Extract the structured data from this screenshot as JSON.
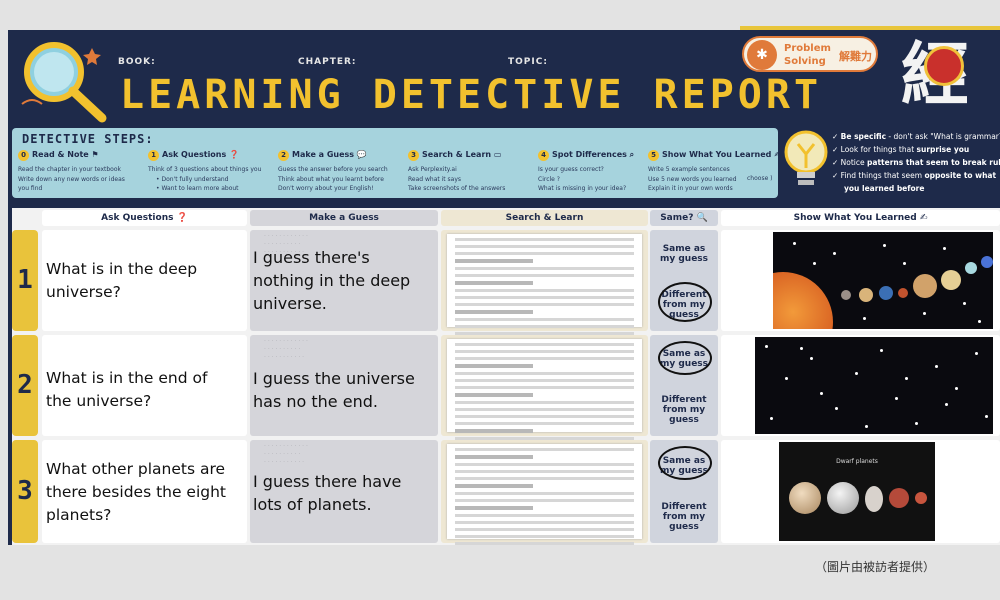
{
  "header": {
    "book_label": "BOOK:",
    "chapter_label": "CHAPTER:",
    "topic_label": "TOPIC:",
    "title": "LEARNING DETECTIVE REPORT",
    "badge_en": "Problem\nSolving",
    "badge_zh": "解難力",
    "logo_char": "經"
  },
  "steps": {
    "title": "DETECTIVE STEPS:",
    "items": [
      {
        "num": "0",
        "title": "Read & Note",
        "lines": [
          "Read the chapter in your textbook",
          "Write down any new words or ideas",
          "you find"
        ]
      },
      {
        "num": "1",
        "title": "Ask Questions ❓",
        "lines": [
          "Think of 3 questions about things you",
          "• Don't fully understand",
          "• Want to learn more about"
        ]
      },
      {
        "num": "2",
        "title": "Make a Guess",
        "lines": [
          "Guess the answer before you search",
          "Think about what you learnt before",
          "Don't worry about your English!"
        ]
      },
      {
        "num": "3",
        "title": "Search & Learn",
        "lines": [
          "Ask Perplexity.ai",
          "Read what it says",
          "Take screenshots of the answers"
        ]
      },
      {
        "num": "4",
        "title": "Spot Differences",
        "lines": [
          "Is your guess correct?",
          "Circle ?",
          "What is missing in your idea?"
        ]
      },
      {
        "num": "5",
        "title": "Show What You Learned ✍",
        "lines": [
          "Write 5 example sentences",
          "Use 5 new words you learned",
          "Explain it in your own words"
        ]
      }
    ],
    "tips": [
      {
        "bold": "Be specific",
        "rest": " - don't ask \"What is grammar?\""
      },
      {
        "pre": "Look for things that ",
        "bold": "surprise you",
        "rest": ""
      },
      {
        "pre": "Notice ",
        "bold": "patterns that seem to break rules",
        "rest": ""
      },
      {
        "pre": "Find things that seem ",
        "bold": "opposite to what",
        "rest": ""
      },
      {
        "bold": "you learned before",
        "rest": ""
      }
    ],
    "choose_text": "choose )"
  },
  "table": {
    "headers": [
      "Ask Questions ❓",
      "Make a Guess",
      "Search & Learn",
      "Same? 🔍",
      "Show What You Learned ✍"
    ],
    "rows": [
      {
        "num": "1",
        "question": "What is in the deep universe?",
        "guess": "I guess there's nothing in the deep universe.",
        "same": "Same as\nmy guess",
        "diff": "Different\nfrom my\nguess"
      },
      {
        "num": "2",
        "question": "What is in the end of the universe?",
        "guess": "I guess the universe has no the end.",
        "same": "Same as\nmy guess",
        "diff": "Different\nfrom my\nguess"
      },
      {
        "num": "3",
        "question": "What other planets are there besides the eight planets?",
        "guess": "I guess there have lots of planets.",
        "same": "Same as\nmy guess",
        "diff": "Different\nfrom my\nguess"
      }
    ],
    "dwarf_label": "Dwarf planets"
  },
  "caption": "（圖片由被訪者提供）",
  "colors": {
    "navy": "#1e2a4a",
    "gold": "#f2c12e",
    "teal": "#a6d3dd"
  }
}
